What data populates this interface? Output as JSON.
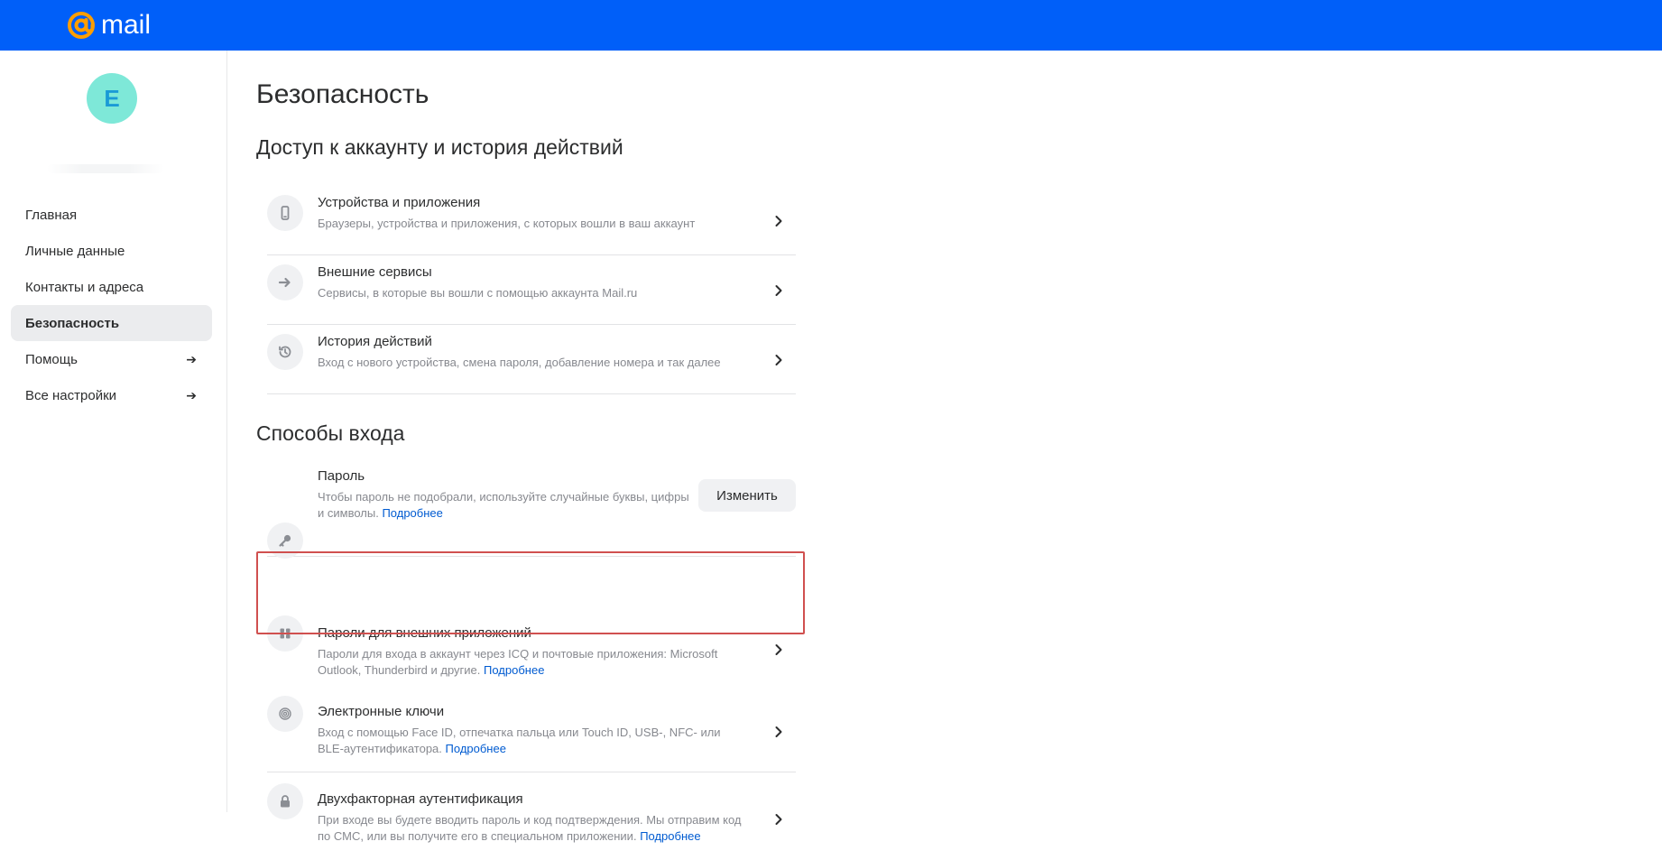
{
  "header": {
    "logo_text": "mail",
    "brand_color": "#005ff9"
  },
  "user": {
    "avatar_letter": "E",
    "avatar_color": "#7ee8d8"
  },
  "sidebar": {
    "items": [
      {
        "label": "Главная",
        "active": false,
        "arrow": false
      },
      {
        "label": "Личные данные",
        "active": false,
        "arrow": false
      },
      {
        "label": "Контакты и адреса",
        "active": false,
        "arrow": false
      },
      {
        "label": "Безопасность",
        "active": true,
        "arrow": false
      },
      {
        "label": "Помощь",
        "active": false,
        "arrow": true
      },
      {
        "label": "Все настройки",
        "active": false,
        "arrow": true
      }
    ],
    "arrow_glyph": "➔"
  },
  "main": {
    "title": "Безопасность",
    "sections": [
      {
        "title": "Доступ к аккаунту и история действий",
        "rows": [
          {
            "icon": "phone-icon",
            "title": "Устройства и приложения",
            "desc": "Браузеры, устройства и приложения, с которых вошли в ваш аккаунт"
          },
          {
            "icon": "arrow-right-icon",
            "title": "Внешние сервисы",
            "desc": "Сервисы, в которые вы вошли с помощью аккаунта Mail.ru"
          },
          {
            "icon": "history-icon",
            "title": "История действий",
            "desc": "Вход с нового устройства, смена пароля, добавление номера и так далее"
          }
        ]
      },
      {
        "title": "Способы входа",
        "rows": [
          {
            "icon": "key-icon",
            "title": "Пароль",
            "desc_line1": "Чтобы пароль не подобрали, используйте случайные буквы, цифры",
            "desc_line2": "и символы.",
            "more": "Подробнее",
            "button": "Изменить"
          },
          {
            "icon": "apps-grid-icon",
            "title": "Пароли для внешних приложений",
            "desc_line1": "Пароли для входа в аккаунт через ICQ и почтовые приложения: Microsoft",
            "desc_line2": "Outlook, Thunderbird и другие.",
            "more": "Подробнее",
            "highlighted": true
          },
          {
            "icon": "fingerprint-icon",
            "title": "Электронные ключи",
            "desc_line1": "Вход с помощью Face ID, отпечатка пальца или Touch ID, USB-, NFC- или",
            "desc_line2": "BLE-аутентификатора.",
            "more": "Подробнее"
          },
          {
            "icon": "lock-icon",
            "title": "Двухфакторная аутентификация",
            "desc_line1": "При входе вы будете вводить пароль и код подтверждения. Мы отправим код",
            "desc_line2": "по СМС, или вы получите его в специальном приложении.",
            "more": "Подробнее"
          }
        ]
      }
    ]
  },
  "colors": {
    "link": "#005bd1",
    "highlight_border": "#d0504f",
    "active_nav_bg": "#ebecee"
  }
}
